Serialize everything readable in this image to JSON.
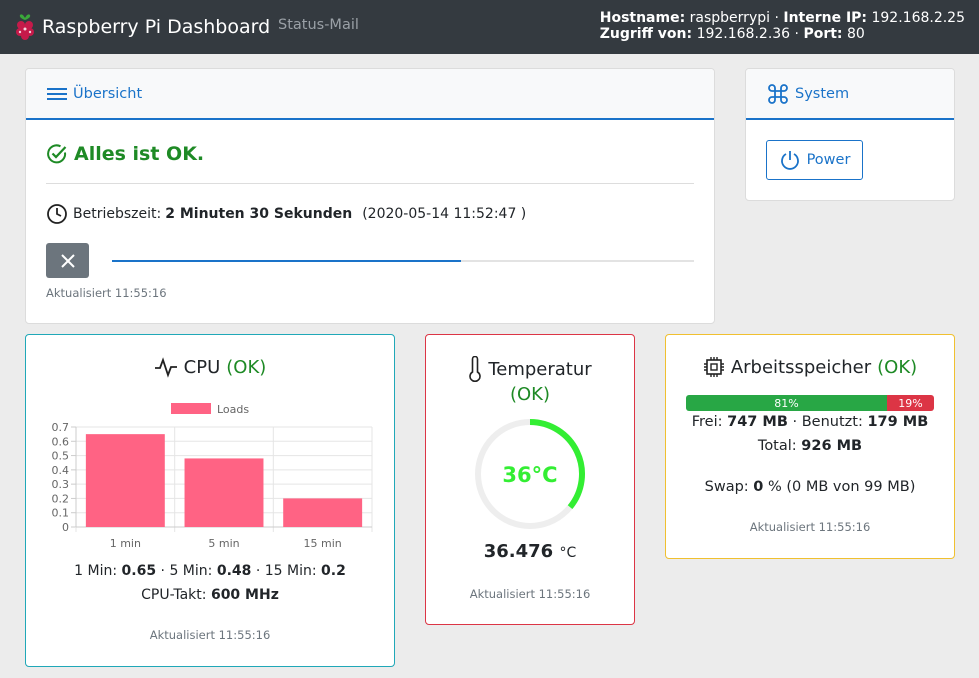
{
  "navbar": {
    "brand": "Raspberry Pi Dashboard",
    "link_status_mail": "Status-Mail",
    "hostname_label": "Hostname:",
    "hostname_value": "raspberrypi",
    "ip_label": "Interne IP:",
    "ip_value": "192.168.2.25",
    "access_label": "Zugriff von:",
    "access_value": "192.168.2.36",
    "port_label": "Port:",
    "port_value": "80"
  },
  "overview": {
    "header": "Übersicht",
    "status": "Alles ist OK.",
    "uptime_label": "Betriebszeit:",
    "uptime_value": "2 Minuten 30 Sekunden",
    "uptime_date": "(2020-05-14 11:52:47 )",
    "progress_percent": 60,
    "updated": "Aktualisiert 11:55:16"
  },
  "system": {
    "header": "System",
    "power_label": "Power"
  },
  "cpu": {
    "title": "CPU",
    "status": "(OK)",
    "load_line_label1": "1 Min:",
    "load1": "0.65",
    "load_line_label5": "· 5 Min:",
    "load5": "0.48",
    "load_line_label15": "· 15 Min:",
    "load15": "0.2",
    "clock_label": "CPU-Takt:",
    "clock_value": "600 MHz",
    "updated": "Aktualisiert 11:55:16"
  },
  "temperature": {
    "title": "Temperatur",
    "status": "(OK)",
    "gauge_text": "36°C",
    "value": "36.476",
    "unit": "°C",
    "gauge_fraction": 0.36,
    "updated": "Aktualisiert 11:55:16"
  },
  "memory": {
    "title": "Arbeitsspeicher",
    "status": "(OK)",
    "used_pct_label": "81%",
    "free_pct_label": "19%",
    "used_fraction": 0.81,
    "free_label": "Frei:",
    "free_value": "747 MB",
    "used_label": "· Benutzt:",
    "used_value": "179 MB",
    "total_label": "Total:",
    "total_value": "926 MB",
    "swap_label": "Swap:",
    "swap_value": "0",
    "swap_rest": "% (0 MB von 99 MB)",
    "updated": "Aktualisiert 11:55:16"
  },
  "colors": {
    "accent": "#1a73c9",
    "ok": "#1e8a25",
    "bar": "#ff6384",
    "gauge": "#33ee33"
  },
  "chart_data": {
    "type": "bar",
    "categories": [
      "1 min",
      "5 min",
      "15 min"
    ],
    "series": [
      {
        "name": "Loads",
        "values": [
          0.65,
          0.48,
          0.2
        ]
      }
    ],
    "ylim": [
      0,
      0.7
    ],
    "yticks": [
      "0",
      "0.1",
      "0.2",
      "0.3",
      "0.4",
      "0.5",
      "0.6",
      "0.7"
    ],
    "grid": true,
    "legend": "top"
  }
}
